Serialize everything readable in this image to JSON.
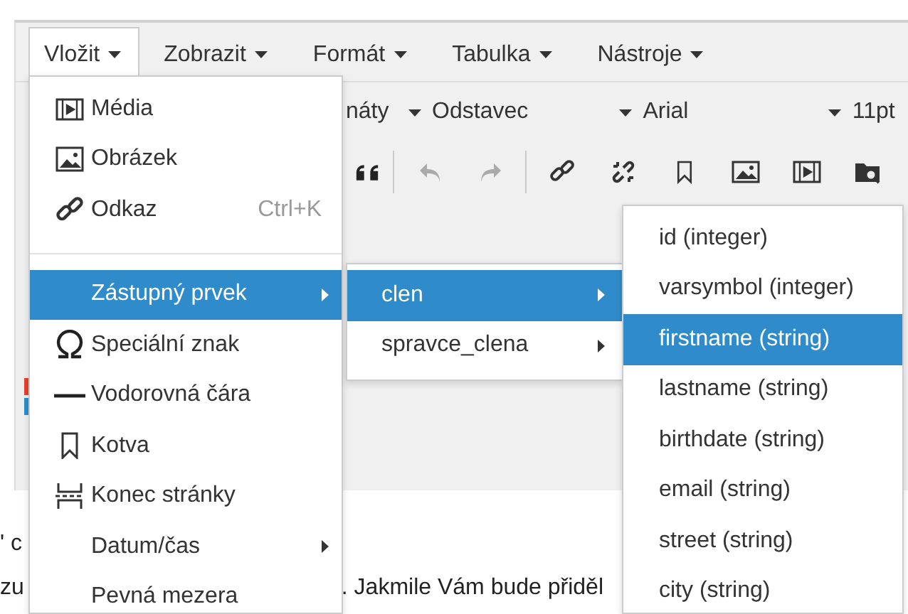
{
  "menubar": [
    {
      "label": "Vložit",
      "selected": true
    },
    {
      "label": "Zobrazit",
      "selected": false
    },
    {
      "label": "Formát",
      "selected": false
    },
    {
      "label": "Tabulka",
      "selected": false
    },
    {
      "label": "Nástroje",
      "selected": false
    }
  ],
  "toolbar": {
    "selects": [
      {
        "label": "náty"
      },
      {
        "label": "Odstavec"
      },
      {
        "label": "Arial"
      },
      {
        "label": "11pt"
      }
    ]
  },
  "insert_menu": {
    "items": [
      {
        "kind": "item",
        "label": "Média",
        "selected": false,
        "has_submenu": false
      },
      {
        "kind": "item",
        "label": "Obrázek",
        "selected": false,
        "has_submenu": false
      },
      {
        "kind": "item",
        "label": "Odkaz",
        "shortcut": "Ctrl+K",
        "selected": false,
        "has_submenu": false
      },
      {
        "kind": "separator"
      },
      {
        "kind": "item",
        "label": "Zástupný prvek",
        "selected": true,
        "has_submenu": true
      },
      {
        "kind": "item",
        "label": "Speciální znak",
        "selected": false,
        "has_submenu": false
      },
      {
        "kind": "item",
        "label": "Vodorovná čára",
        "selected": false,
        "has_submenu": false
      },
      {
        "kind": "item",
        "label": "Kotva",
        "selected": false,
        "has_submenu": false
      },
      {
        "kind": "item",
        "label": "Konec stránky",
        "selected": false,
        "has_submenu": false
      },
      {
        "kind": "item",
        "label": "Datum/čas",
        "selected": false,
        "has_submenu": true
      },
      {
        "kind": "item",
        "label": "Pevná mezera",
        "selected": false,
        "has_submenu": false
      }
    ]
  },
  "placeholder_menu": {
    "items": [
      {
        "label": "clen",
        "selected": true,
        "has_submenu": true
      },
      {
        "label": "spravce_clena",
        "selected": false,
        "has_submenu": true
      }
    ]
  },
  "field_menu": {
    "items": [
      {
        "label": "id (integer)",
        "selected": false
      },
      {
        "label": "varsymbol (integer)",
        "selected": false
      },
      {
        "label": "firstname (string)",
        "selected": true
      },
      {
        "label": "lastname (string)",
        "selected": false
      },
      {
        "label": "birthdate (string)",
        "selected": false
      },
      {
        "label": "email (string)",
        "selected": false
      },
      {
        "label": "street (string)",
        "selected": false
      },
      {
        "label": "city (string)",
        "selected": false
      }
    ]
  },
  "content": {
    "lines": [
      {
        "segments": [
          "' c"
        ]
      },
      {
        "segments": [
          "zu",
          ". Jakmile Vám bude přiděl"
        ]
      }
    ]
  }
}
